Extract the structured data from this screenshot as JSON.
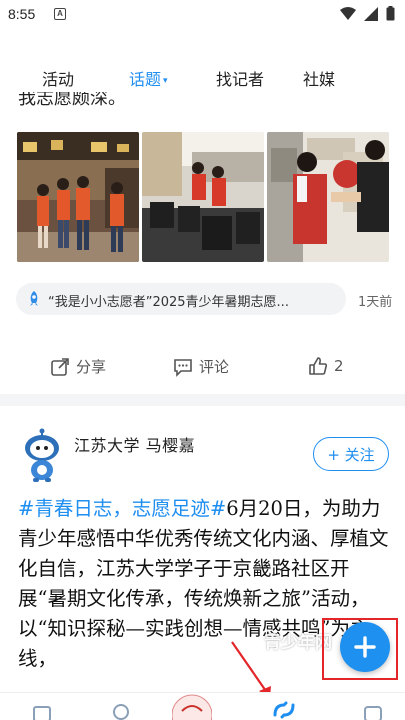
{
  "status": {
    "time": "8:55",
    "app_badge": "A"
  },
  "tabs": [
    {
      "label": "活动"
    },
    {
      "label": "话题"
    },
    {
      "label": "找记者"
    },
    {
      "label": "社媒"
    }
  ],
  "tab_caret": "▾",
  "prior_post_tail": "我志愿颇深。",
  "topic": {
    "label": "“我是小小志愿者”2025青少年暑期志愿...",
    "time_ago": "1天前"
  },
  "actions": {
    "share": "分享",
    "comment": "评论",
    "like_count": "2"
  },
  "post": {
    "author": "江苏大学 马樱嘉",
    "follow_label": "+ 关注",
    "hashtag": "#青春日志，志愿足迹#",
    "body": "6月20日，为助力青少年感悟中华优秀传统文化内涵、厚植文化自信，江苏大学学子于京畿路社区开展“暑期文化传承，传统焕新之旅”活动，以“知识探秘—实践创想—情感共鸣”为主线，"
  },
  "watermark": "青少年网",
  "colors": {
    "accent": "#1f8ef1",
    "highlight": "#e3262a"
  }
}
